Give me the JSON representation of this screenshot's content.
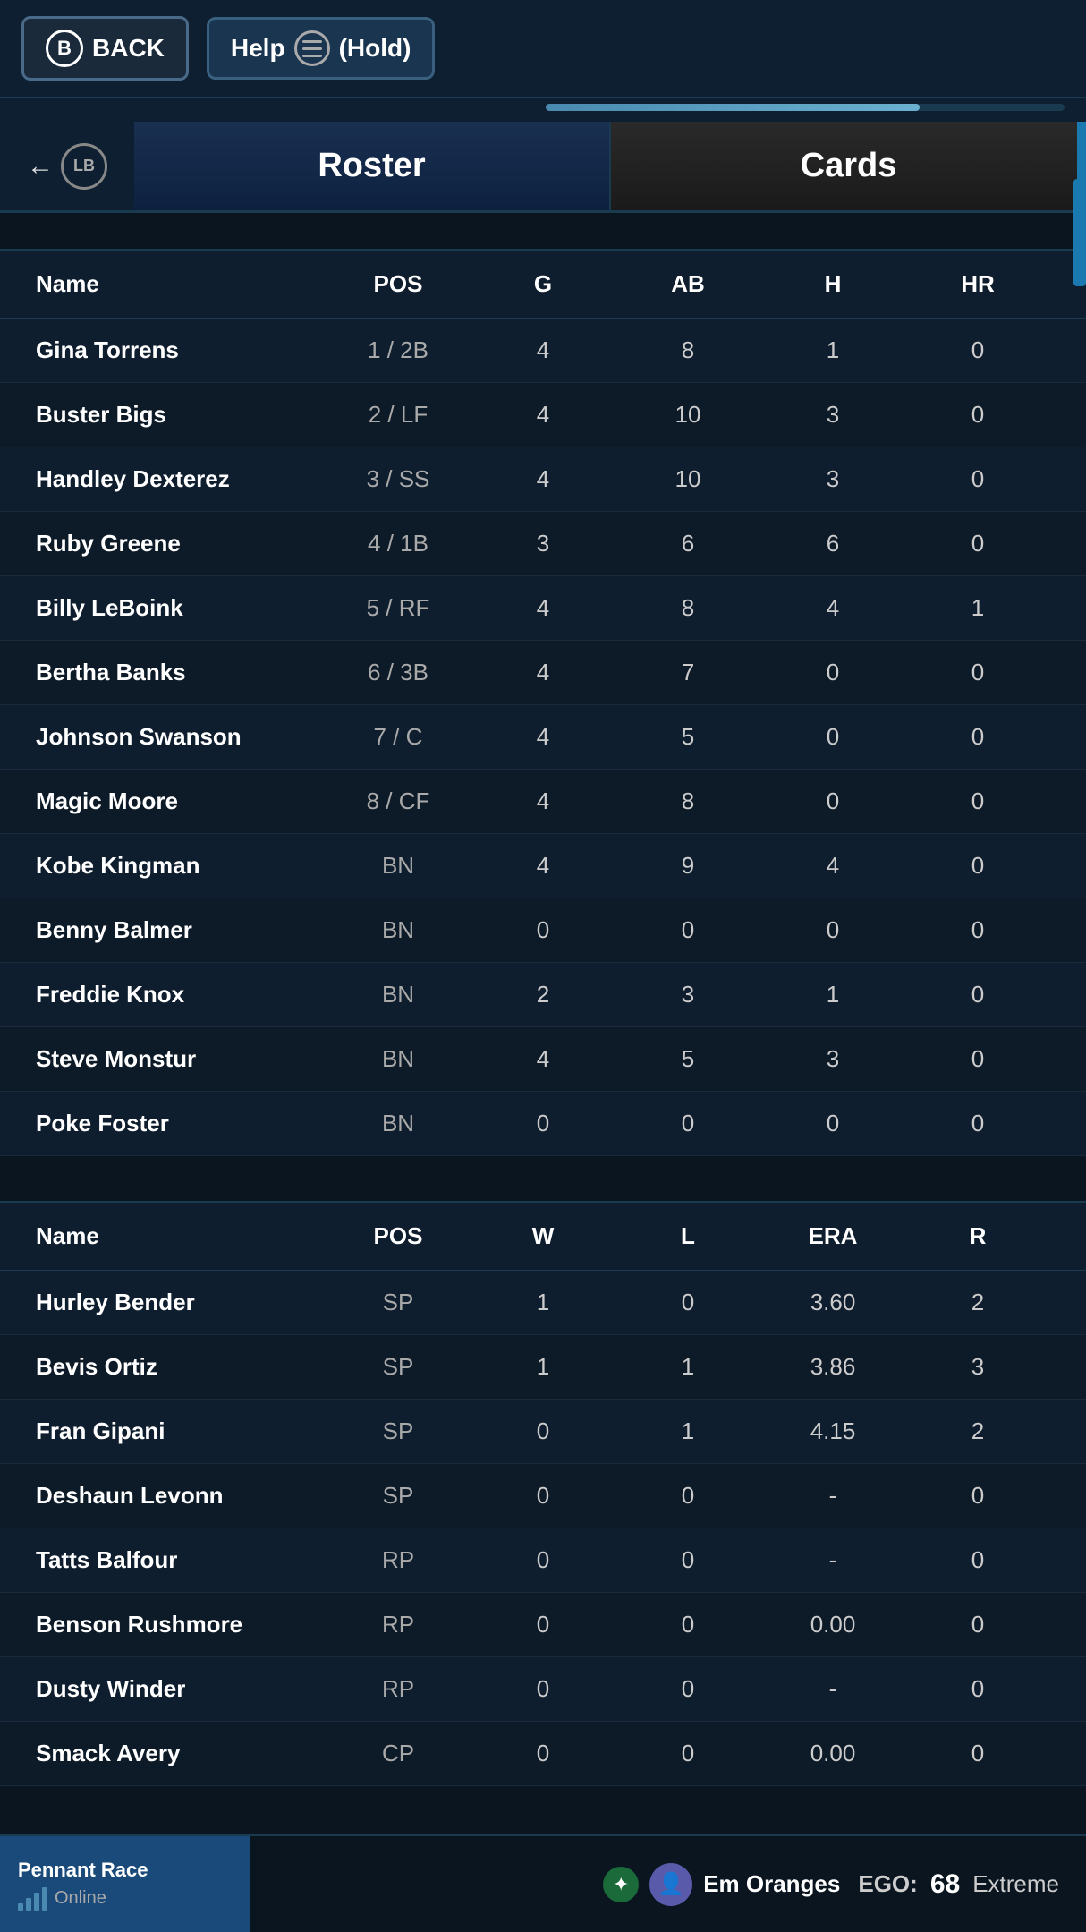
{
  "topBar": {
    "backLabel": "BACK",
    "bButton": "B",
    "helpLabel": "Help",
    "holdLabel": "(Hold)"
  },
  "tabs": {
    "lbButton": "LB",
    "rosterLabel": "Roster",
    "cardsLabel": "Cards"
  },
  "battersTable": {
    "headers": [
      "Name",
      "POS",
      "G",
      "AB",
      "H",
      "HR"
    ],
    "rows": [
      {
        "name": "Gina Torrens",
        "pos": "1 / 2B",
        "g": "4",
        "ab": "8",
        "h": "1",
        "hr": "0"
      },
      {
        "name": "Buster Bigs",
        "pos": "2 / LF",
        "g": "4",
        "ab": "10",
        "h": "3",
        "hr": "0"
      },
      {
        "name": "Handley Dexterez",
        "pos": "3 / SS",
        "g": "4",
        "ab": "10",
        "h": "3",
        "hr": "0"
      },
      {
        "name": "Ruby Greene",
        "pos": "4 / 1B",
        "g": "3",
        "ab": "6",
        "h": "6",
        "hr": "0"
      },
      {
        "name": "Billy LeBoink",
        "pos": "5 / RF",
        "g": "4",
        "ab": "8",
        "h": "4",
        "hr": "1"
      },
      {
        "name": "Bertha Banks",
        "pos": "6 / 3B",
        "g": "4",
        "ab": "7",
        "h": "0",
        "hr": "0"
      },
      {
        "name": "Johnson Swanson",
        "pos": "7 / C",
        "g": "4",
        "ab": "5",
        "h": "0",
        "hr": "0"
      },
      {
        "name": "Magic Moore",
        "pos": "8 / CF",
        "g": "4",
        "ab": "8",
        "h": "0",
        "hr": "0"
      },
      {
        "name": "Kobe Kingman",
        "pos": "BN",
        "g": "4",
        "ab": "9",
        "h": "4",
        "hr": "0"
      },
      {
        "name": "Benny Balmer",
        "pos": "BN",
        "g": "0",
        "ab": "0",
        "h": "0",
        "hr": "0"
      },
      {
        "name": "Freddie Knox",
        "pos": "BN",
        "g": "2",
        "ab": "3",
        "h": "1",
        "hr": "0"
      },
      {
        "name": "Steve Monstur",
        "pos": "BN",
        "g": "4",
        "ab": "5",
        "h": "3",
        "hr": "0"
      },
      {
        "name": "Poke Foster",
        "pos": "BN",
        "g": "0",
        "ab": "0",
        "h": "0",
        "hr": "0"
      }
    ]
  },
  "pitchersTable": {
    "headers": [
      "Name",
      "POS",
      "W",
      "L",
      "ERA",
      "R"
    ],
    "rows": [
      {
        "name": "Hurley Bender",
        "pos": "SP",
        "w": "1",
        "l": "0",
        "era": "3.60",
        "r": "2"
      },
      {
        "name": "Bevis Ortiz",
        "pos": "SP",
        "w": "1",
        "l": "1",
        "era": "3.86",
        "r": "3"
      },
      {
        "name": "Fran Gipani",
        "pos": "SP",
        "w": "0",
        "l": "1",
        "era": "4.15",
        "r": "2"
      },
      {
        "name": "Deshaun Levonn",
        "pos": "SP",
        "w": "0",
        "l": "0",
        "era": "-",
        "r": "0"
      },
      {
        "name": "Tatts Balfour",
        "pos": "RP",
        "w": "0",
        "l": "0",
        "era": "-",
        "r": "0"
      },
      {
        "name": "Benson Rushmore",
        "pos": "RP",
        "w": "0",
        "l": "0",
        "era": "0.00",
        "r": "0"
      },
      {
        "name": "Dusty Winder",
        "pos": "RP",
        "w": "0",
        "l": "0",
        "era": "-",
        "r": "0"
      },
      {
        "name": "Smack Avery",
        "pos": "CP",
        "w": "0",
        "l": "0",
        "era": "0.00",
        "r": "0"
      }
    ]
  },
  "bottomBar": {
    "pennantRaceLabel": "Pennant Race",
    "onlineLabel": "Online",
    "username": "Em Oranges",
    "egoLabel": "EGO:",
    "egoValue": "68",
    "extremeLabel": "Extreme"
  },
  "progressBar": {
    "fillPercent": 72
  }
}
